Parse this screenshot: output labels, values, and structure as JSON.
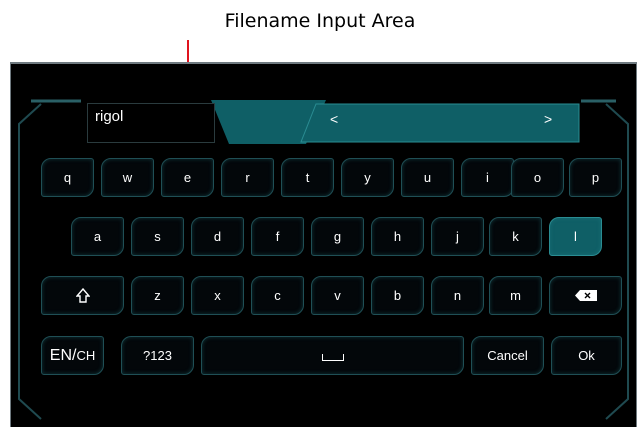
{
  "annotation": {
    "label": "Filename Input Area"
  },
  "input": {
    "value": "rigol"
  },
  "nav": {
    "prev": "<",
    "next": ">"
  },
  "rows": [
    [
      "q",
      "w",
      "e",
      "r",
      "t",
      "y",
      "u",
      "i",
      "o",
      "p"
    ],
    [
      "a",
      "s",
      "d",
      "f",
      "g",
      "h",
      "j",
      "k",
      "l"
    ],
    [
      "z",
      "x",
      "c",
      "v",
      "b",
      "n",
      "m"
    ]
  ],
  "selected_key": "l",
  "bottom": {
    "lang_en": "EN/",
    "lang_ch": "CH",
    "symbols": "?123",
    "cancel": "Cancel",
    "ok": "Ok"
  },
  "icons": {
    "shift": "shift-icon",
    "backspace": "backspace-icon",
    "space": "space-icon"
  },
  "colors": {
    "accent": "#0f5f66",
    "key_border": "#1f4f55",
    "panel": "#000000"
  }
}
